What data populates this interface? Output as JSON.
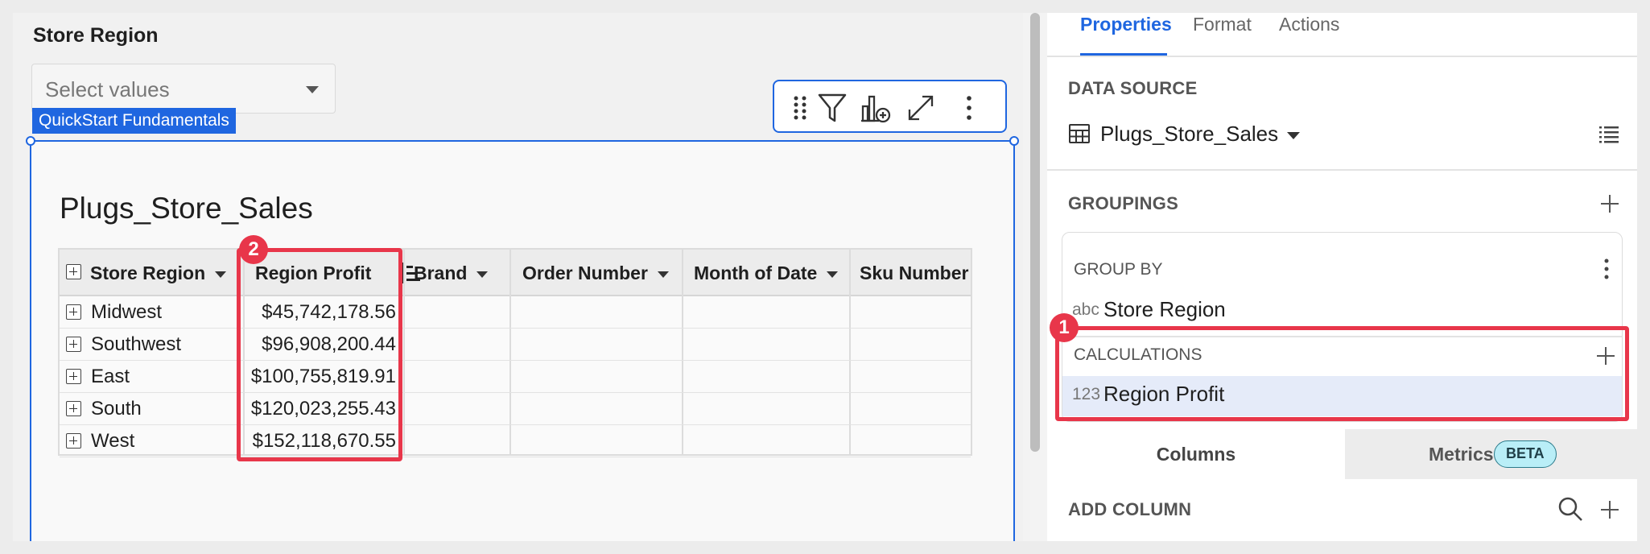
{
  "filter": {
    "title": "Store Region",
    "placeholder": "Select values",
    "source_tag": "QuickStart Fundamentals"
  },
  "toolbar": {
    "icons": [
      "drag-handle-icon",
      "filter-icon",
      "add-chart-icon",
      "expand-icon",
      "more-vertical-icon"
    ]
  },
  "table": {
    "title": "Plugs_Store_Sales",
    "columns": [
      "Store Region",
      "Region Profit",
      "Brand",
      "Order Number",
      "Month of Date",
      "Sku Number"
    ],
    "rows": [
      {
        "region": "Midwest",
        "profit": "$45,742,178.56"
      },
      {
        "region": "Southwest",
        "profit": "$96,908,200.44"
      },
      {
        "region": "East",
        "profit": "$100,755,819.91"
      },
      {
        "region": "South",
        "profit": "$120,023,255.43"
      },
      {
        "region": "West",
        "profit": "$152,118,670.55"
      }
    ]
  },
  "annotations": {
    "badge_1": "1",
    "badge_2": "2",
    "highlight_color": "#e8364a"
  },
  "panel": {
    "tabs": [
      "Properties",
      "Format",
      "Actions"
    ],
    "data_source_label": "DATA SOURCE",
    "data_source_name": "Plugs_Store_Sales",
    "groupings_label": "GROUPINGS",
    "group_by_label": "GROUP BY",
    "group_field_type": "abc",
    "group_field": "Store Region",
    "calculations_label": "CALCULATIONS",
    "calc_field_type": "123",
    "calc_field": "Region Profit",
    "columns_tab": "Columns",
    "metrics_tab": "Metrics",
    "beta_badge": "BETA",
    "add_column_label": "ADD COLUMN"
  },
  "colors": {
    "accent": "#1f66e0",
    "selection": "#e5ebf9"
  }
}
